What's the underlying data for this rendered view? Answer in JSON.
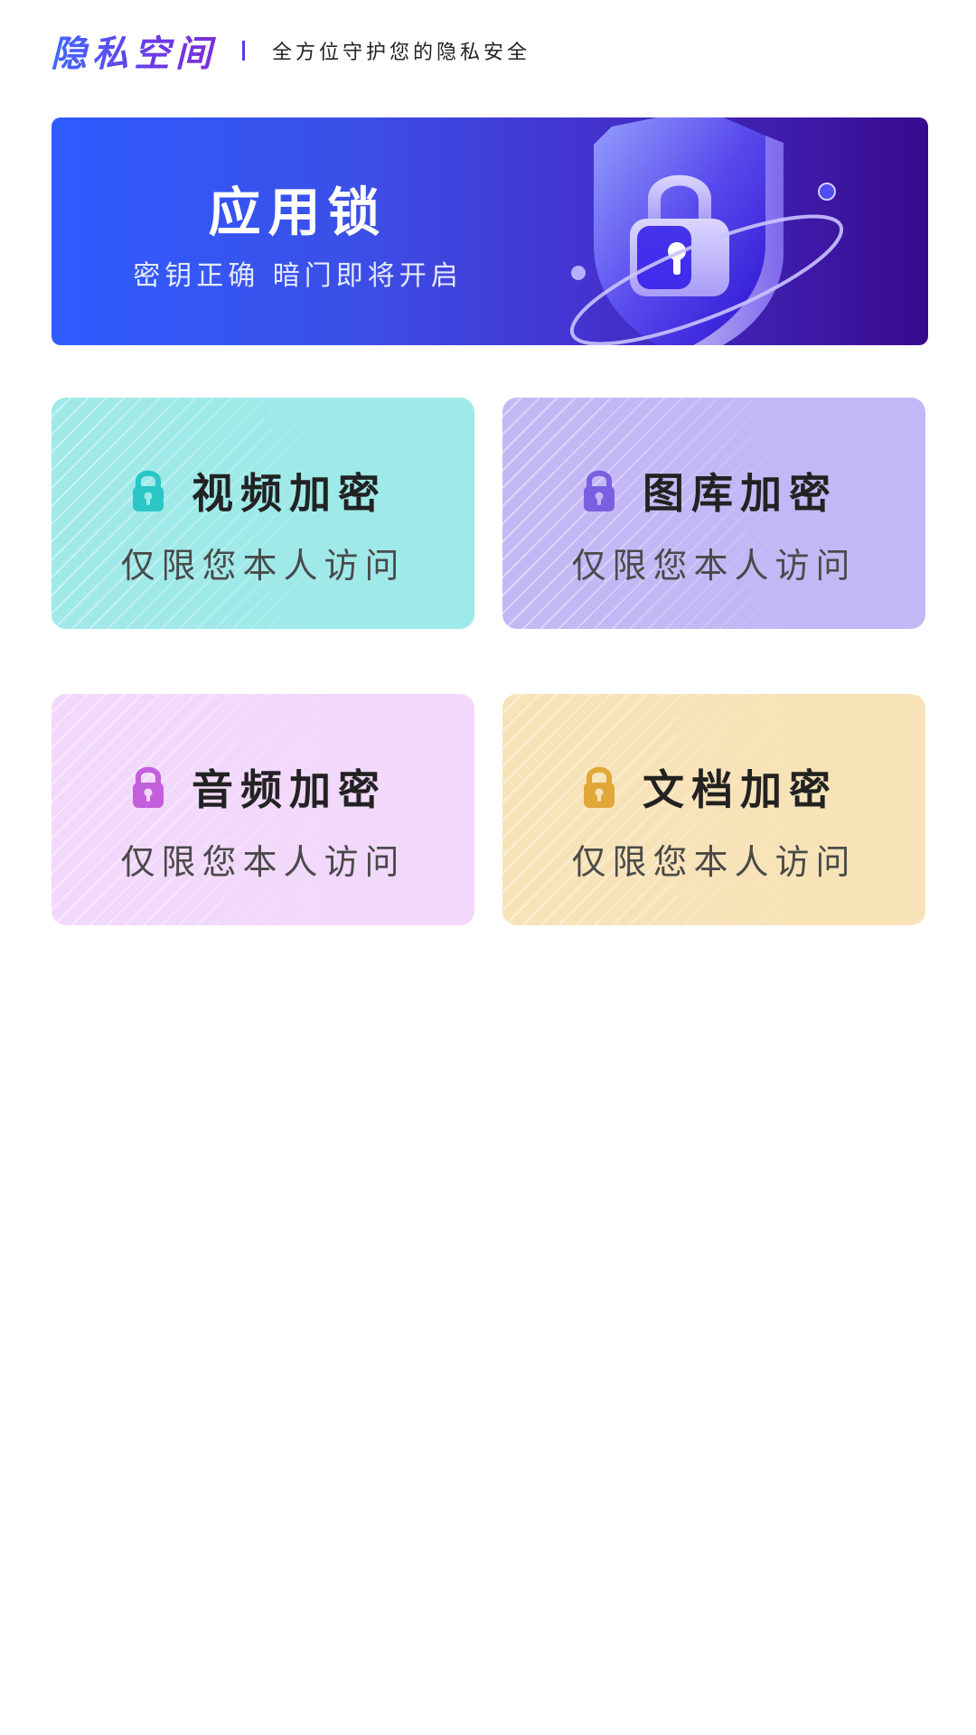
{
  "header": {
    "brand": "隐私空间",
    "tagline": "全方位守护您的隐私安全"
  },
  "banner": {
    "title": "应用锁",
    "subtitle": "密钥正确 暗门即将开启"
  },
  "cards": [
    {
      "title": "视频加密",
      "subtitle": "仅限您本人访问",
      "icon": "lock-icon",
      "accent": "#2bc6c6"
    },
    {
      "title": "图库加密",
      "subtitle": "仅限您本人访问",
      "icon": "lock-icon",
      "accent": "#7a5fe0"
    },
    {
      "title": "音频加密",
      "subtitle": "仅限您本人访问",
      "icon": "lock-icon",
      "accent": "#c45fdc"
    },
    {
      "title": "文档加密",
      "subtitle": "仅限您本人访问",
      "icon": "lock-icon",
      "accent": "#dfa838"
    }
  ],
  "colors": {
    "brand_gradient_start": "#3f6bff",
    "brand_gradient_end": "#7b2fd8",
    "banner_start": "#2f5cff",
    "banner_end": "#370a8e",
    "video_bg": "#9fe9e9",
    "gallery_bg": "#c3b8f5",
    "audio_bg": "#f2d8fb",
    "doc_bg": "#f7e3b7"
  }
}
